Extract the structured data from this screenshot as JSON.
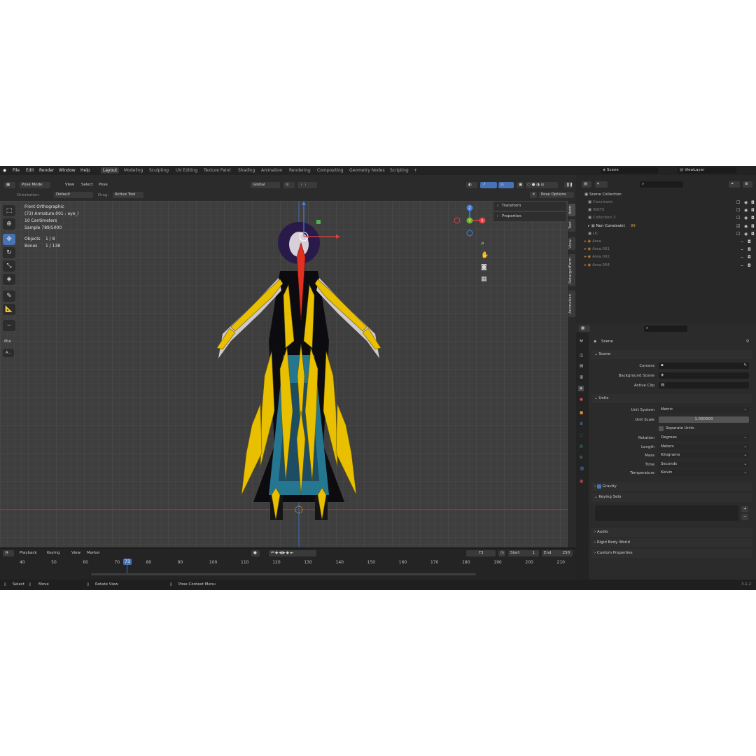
{
  "app": {
    "menus": [
      "File",
      "Edit",
      "Render",
      "Window",
      "Help"
    ],
    "workspaces": [
      "Layout",
      "Modeling",
      "Sculpting",
      "UV Editing",
      "Texture Paint",
      "Shading",
      "Animation",
      "Rendering",
      "Compositing",
      "Geometry Nodes",
      "Scripting"
    ],
    "active_workspace": "Layout",
    "add_tab": "+",
    "scene_name": "Scene",
    "view_layer": "ViewLayer",
    "version": "3.1.2"
  },
  "viewport_header": {
    "mode": "Pose Mode",
    "menus": [
      "View",
      "Select",
      "Pose"
    ],
    "transform_orientation": "Global",
    "orientation_label": "Orientation:",
    "orientation_value": "Default",
    "drag_label": "Drag:",
    "drag_value": "Active Tool",
    "pose_options": "Pose Options"
  },
  "viewport_info": {
    "view_name": "Front Orthographic",
    "active": "(73) Armature.001 : eye_l",
    "scale": "10 Centimeters",
    "sample": "Sample 789/5000",
    "objects_label": "Objects",
    "objects_value": "1 / 8",
    "bones_label": "Bones",
    "bones_value": "1 / 138"
  },
  "gizmo": {
    "x": "X",
    "y": "Y",
    "z": "Z"
  },
  "npanel": {
    "sections": [
      "Transform",
      "Properties"
    ],
    "tabs": [
      "Item",
      "Tool",
      "View",
      "RetargetFarm",
      "Animation"
    ]
  },
  "left_toolbar": {
    "mul_label": "Mul",
    "a_label": "A..."
  },
  "outliner": {
    "root": "Scene Collection",
    "items": [
      {
        "name": "Constraint",
        "dim": true,
        "indent": 1
      },
      {
        "name": "WGTS",
        "dim": true,
        "indent": 1
      },
      {
        "name": "Collection 3",
        "dim": true,
        "indent": 1
      },
      {
        "name": "Non Constraint",
        "dim": false,
        "indent": 1,
        "extra": "99"
      },
      {
        "name": "UC",
        "dim": true,
        "indent": 1
      },
      {
        "name": "Area",
        "dim": true,
        "indent": 1
      },
      {
        "name": "Area.001",
        "dim": true,
        "indent": 1
      },
      {
        "name": "Area.002",
        "dim": true,
        "indent": 1
      },
      {
        "name": "Area.004",
        "dim": true,
        "indent": 1
      }
    ]
  },
  "properties": {
    "title": "Scene",
    "scene_section": "Scene",
    "camera_label": "Camera",
    "background_scene_label": "Background Scene",
    "active_clip_label": "Active Clip",
    "units_section": "Units",
    "unit_system_label": "Unit System",
    "unit_system": "Metric",
    "unit_scale_label": "Unit Scale",
    "unit_scale": "1.000000",
    "separate_units": "Separate Units",
    "rotation_label": "Rotation",
    "rotation": "Degrees",
    "length_label": "Length",
    "length": "Meters",
    "mass_label": "Mass",
    "mass": "Kilograms",
    "time_label": "Time",
    "time": "Seconds",
    "temperature_label": "Temperature",
    "temperature": "Kelvin",
    "gravity": "Gravity",
    "keying_sets": "Keying Sets",
    "audio": "Audio",
    "rigid_body_world": "Rigid Body World",
    "custom_properties": "Custom Properties"
  },
  "timeline": {
    "menus": [
      "Playback",
      "Keying",
      "View",
      "Marker"
    ],
    "current_frame": "73",
    "start_label": "Start",
    "start": "1",
    "end_label": "End",
    "end": "250",
    "ticks": [
      "40",
      "50",
      "60",
      "70",
      "80",
      "90",
      "100",
      "110",
      "120",
      "130",
      "140",
      "150",
      "160",
      "170",
      "180",
      "190",
      "200",
      "210"
    ],
    "playhead": "73"
  },
  "statusbar": {
    "select": "Select",
    "move": "Move",
    "rotate_view": "Rotate View",
    "pose_context_menu": "Pose Context Menu"
  },
  "colors": {
    "accent": "#4772b3",
    "armature_yellow": "#e8c000",
    "selected_bone_red": "#e03020",
    "dress_teal": "#2a8aa8"
  }
}
